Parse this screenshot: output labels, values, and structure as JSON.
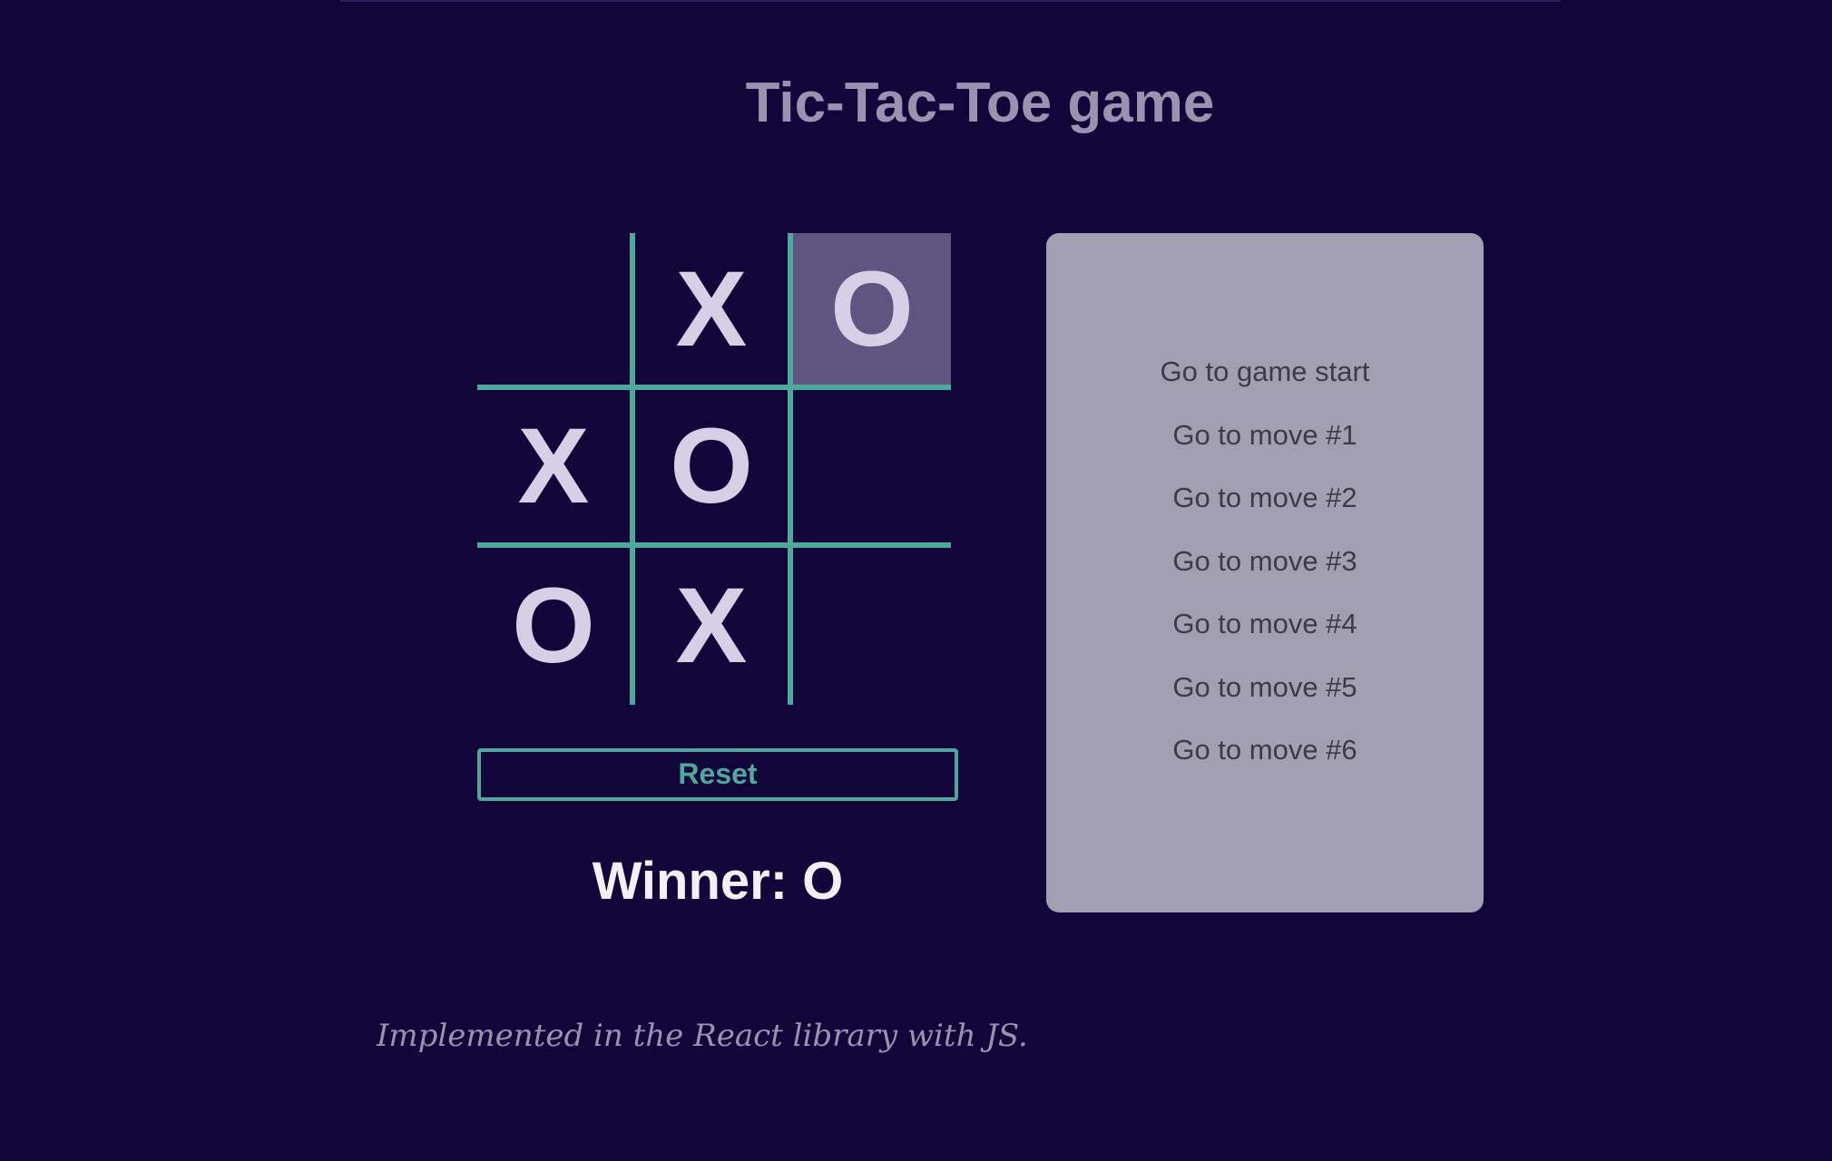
{
  "title": "Tic-Tac-Toe game",
  "board": {
    "cells": [
      "",
      "X",
      "O",
      "X",
      "O",
      "",
      "O",
      "X",
      ""
    ],
    "highlighted_cell": 2
  },
  "reset_label": "Reset",
  "status": "Winner: O",
  "history": [
    "Go to game start",
    "Go to move #1",
    "Go to move #2",
    "Go to move #3",
    "Go to move #4",
    "Go to move #5",
    "Go to move #6"
  ],
  "footer": "Implemented in the React library with JS.",
  "colors": {
    "background": "#11053a",
    "grid_line": "#4fa89c",
    "mark": "#d6d0e6",
    "highlight": "#5e5580",
    "panel": "#a39fb3"
  }
}
